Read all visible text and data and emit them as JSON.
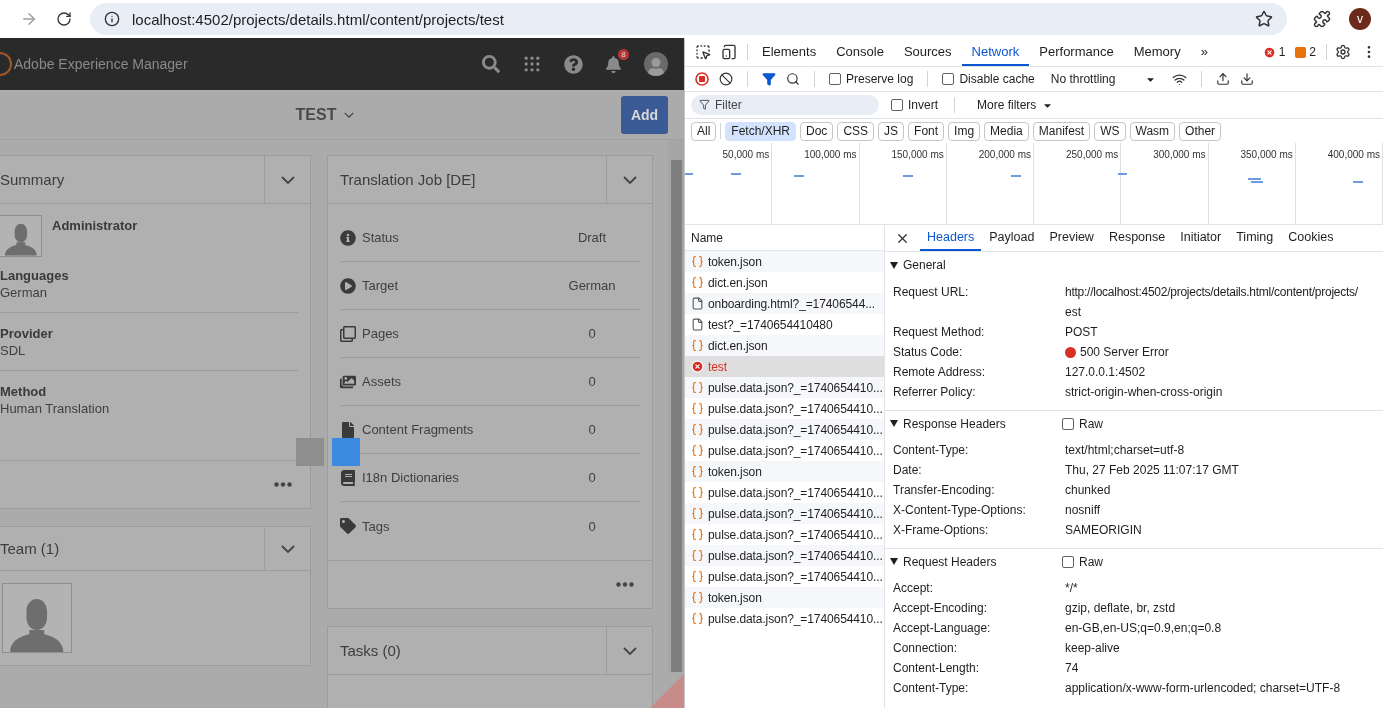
{
  "browser": {
    "url": "localhost:4502/projects/details.html/content/projects/test",
    "profile_initial": "v"
  },
  "aem": {
    "product": "Adobe Experience Manager",
    "notification_count": "8",
    "page_title": "TEST",
    "add_button": "Add",
    "summary": {
      "title": "Summary",
      "user": "Administrator",
      "fields": [
        {
          "label": "Languages",
          "value": "German"
        },
        {
          "label": "Provider",
          "value": "SDL"
        },
        {
          "label": "Method",
          "value": "Human Translation"
        }
      ]
    },
    "team": {
      "title": "Team (1)"
    },
    "translation_job": {
      "title": "Translation Job [DE]",
      "rows": [
        {
          "kind": "status",
          "label": "Status",
          "value": "Draft"
        },
        {
          "kind": "target",
          "label": "Target",
          "value": "German"
        },
        {
          "kind": "pages",
          "label": "Pages",
          "value": "0"
        },
        {
          "kind": "assets",
          "label": "Assets",
          "value": "0"
        },
        {
          "kind": "fragments",
          "label": "Content Fragments",
          "value": "0"
        },
        {
          "kind": "dictionaries",
          "label": "I18n Dictionaries",
          "value": "0"
        },
        {
          "kind": "tags",
          "label": "Tags",
          "value": "0"
        }
      ]
    },
    "tasks": {
      "title": "Tasks (0)"
    }
  },
  "devtools": {
    "panel_tabs": [
      {
        "label": "Elements",
        "selected": false
      },
      {
        "label": "Console",
        "selected": false
      },
      {
        "label": "Sources",
        "selected": false
      },
      {
        "label": "Network",
        "selected": true
      },
      {
        "label": "Performance",
        "selected": false
      },
      {
        "label": "Memory",
        "selected": false
      }
    ],
    "more_tabs": "»",
    "error_count": "1",
    "warning_count": "2",
    "toolbar": {
      "preserve_log": {
        "label": "Preserve log",
        "checked": false
      },
      "disable_cache": {
        "label": "Disable cache",
        "checked": false
      },
      "throttling": "No throttling"
    },
    "filter": {
      "placeholder": "Filter",
      "invert": {
        "label": "Invert",
        "checked": false
      },
      "more_filters": "More filters"
    },
    "type_filters": [
      {
        "label": "All",
        "selected": false
      },
      {
        "label": "Fetch/XHR",
        "selected": true
      },
      {
        "label": "Doc",
        "selected": false
      },
      {
        "label": "CSS",
        "selected": false
      },
      {
        "label": "JS",
        "selected": false
      },
      {
        "label": "Font",
        "selected": false
      },
      {
        "label": "Img",
        "selected": false
      },
      {
        "label": "Media",
        "selected": false
      },
      {
        "label": "Manifest",
        "selected": false
      },
      {
        "label": "WS",
        "selected": false
      },
      {
        "label": "Wasm",
        "selected": false
      },
      {
        "label": "Other",
        "selected": false
      }
    ],
    "overview_ticks": [
      "50,000 ms",
      "100,000 ms",
      "150,000 ms",
      "200,000 ms",
      "250,000 ms",
      "300,000 ms",
      "350,000 ms",
      "400,000 ms"
    ],
    "requests": {
      "column": "Name",
      "rows": [
        {
          "name": "token.json",
          "kind": "json",
          "selected": false
        },
        {
          "name": "dict.en.json",
          "kind": "json",
          "selected": false
        },
        {
          "name": "onboarding.html?_=17406544...",
          "kind": "document",
          "selected": false
        },
        {
          "name": "test?_=1740654410480",
          "kind": "document",
          "selected": false
        },
        {
          "name": "dict.en.json",
          "kind": "json",
          "selected": false
        },
        {
          "name": "test",
          "kind": "error",
          "selected": true
        },
        {
          "name": "pulse.data.json?_=1740654410...",
          "kind": "json",
          "selected": false
        },
        {
          "name": "pulse.data.json?_=1740654410...",
          "kind": "json",
          "selected": false
        },
        {
          "name": "pulse.data.json?_=1740654410...",
          "kind": "json",
          "selected": false
        },
        {
          "name": "pulse.data.json?_=1740654410...",
          "kind": "json",
          "selected": false
        },
        {
          "name": "token.json",
          "kind": "json",
          "selected": false
        },
        {
          "name": "pulse.data.json?_=1740654410...",
          "kind": "json",
          "selected": false
        },
        {
          "name": "pulse.data.json?_=1740654410...",
          "kind": "json",
          "selected": false
        },
        {
          "name": "pulse.data.json?_=1740654410...",
          "kind": "json",
          "selected": false
        },
        {
          "name": "pulse.data.json?_=1740654410...",
          "kind": "json",
          "selected": false
        },
        {
          "name": "pulse.data.json?_=1740654410...",
          "kind": "json",
          "selected": false
        },
        {
          "name": "token.json",
          "kind": "json",
          "selected": false
        },
        {
          "name": "pulse.data.json?_=1740654410...",
          "kind": "json",
          "selected": false
        }
      ]
    },
    "detail_tabs": [
      {
        "label": "Headers",
        "selected": true
      },
      {
        "label": "Payload",
        "selected": false
      },
      {
        "label": "Preview",
        "selected": false
      },
      {
        "label": "Response",
        "selected": false
      },
      {
        "label": "Initiator",
        "selected": false
      },
      {
        "label": "Timing",
        "selected": false
      },
      {
        "label": "Cookies",
        "selected": false
      }
    ],
    "sections": [
      {
        "title": "General",
        "expanded": true,
        "rows": [
          {
            "kind": "text",
            "key": "Request URL:",
            "value": "http://localhost:4502/projects/details.html/content/projects/",
            "continued": "est"
          },
          {
            "kind": "text",
            "key": "Request Method:",
            "value": "POST"
          },
          {
            "kind": "status",
            "key": "Status Code:",
            "value": "500 Server Error"
          },
          {
            "kind": "text",
            "key": "Remote Address:",
            "value": "127.0.0.1:4502"
          },
          {
            "kind": "text",
            "key": "Referrer Policy:",
            "value": "strict-origin-when-cross-origin"
          }
        ]
      },
      {
        "title": "Response Headers",
        "expanded": true,
        "raw": {
          "label": "Raw",
          "checked": false
        },
        "rows": [
          {
            "kind": "text",
            "key": "Content-Type:",
            "value": "text/html;charset=utf-8"
          },
          {
            "kind": "text",
            "key": "Date:",
            "value": "Thu, 27 Feb 2025 11:07:17 GMT"
          },
          {
            "kind": "text",
            "key": "Transfer-Encoding:",
            "value": "chunked"
          },
          {
            "kind": "text",
            "key": "X-Content-Type-Options:",
            "value": "nosniff"
          },
          {
            "kind": "text",
            "key": "X-Frame-Options:",
            "value": "SAMEORIGIN"
          }
        ]
      },
      {
        "title": "Request Headers",
        "expanded": true,
        "raw": {
          "label": "Raw",
          "checked": false
        },
        "rows": [
          {
            "kind": "text",
            "key": "Accept:",
            "value": "*/*"
          },
          {
            "kind": "text",
            "key": "Accept-Encoding:",
            "value": "gzip, deflate, br, zstd"
          },
          {
            "kind": "text",
            "key": "Accept-Language:",
            "value": "en-GB,en-US;q=0.9,en;q=0.8"
          },
          {
            "kind": "text",
            "key": "Connection:",
            "value": "keep-alive"
          },
          {
            "kind": "text",
            "key": "Content-Length:",
            "value": "74"
          },
          {
            "kind": "text",
            "key": "Content-Type:",
            "value": "application/x-www-form-urlencoded; charset=UTF-8"
          }
        ]
      }
    ]
  }
}
